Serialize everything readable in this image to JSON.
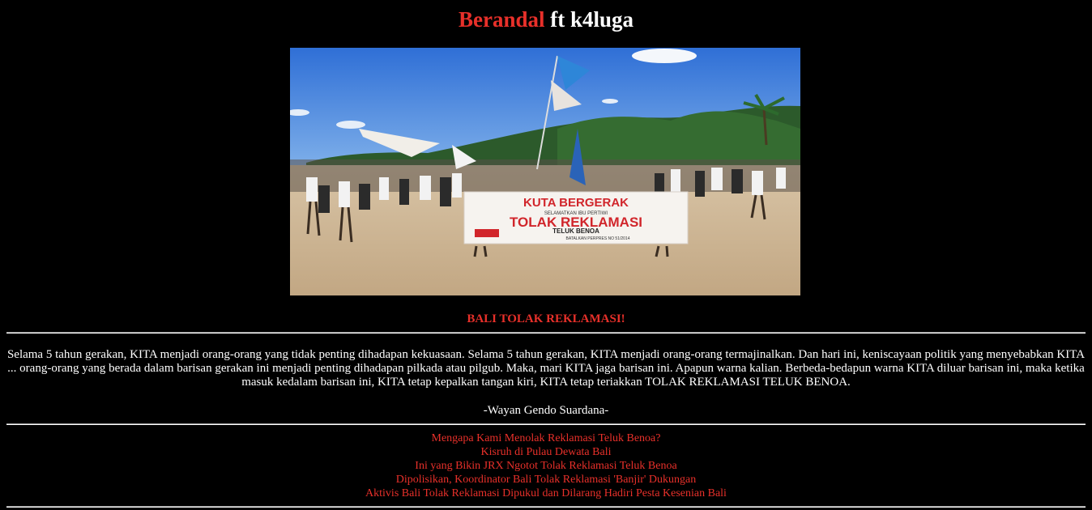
{
  "header": {
    "title_red": "Berandal",
    "title_white": " ft k4luga"
  },
  "photo": {
    "description_icon": "protest-photo",
    "banner": {
      "line1": "KUTA BERGERAK",
      "line2": "SELAMATKAN IBU PERTIWI",
      "line3": "TOLAK REKLAMASI",
      "line4": "TELUK BENOA",
      "line5": "BATALKAN PERPRES NO 51/2014"
    }
  },
  "main": {
    "headline": "BALI TOLAK REKLAMASI!",
    "paragraph": "Selama 5 tahun gerakan, KITA menjadi orang-orang yang tidak penting dihadapan kekuasaan. Selama 5 tahun gerakan, KITA menjadi orang-orang termajinalkan. Dan hari ini, keniscayaan politik yang menyebabkan KITA ... orang-orang yang berada dalam barisan gerakan ini menjadi penting dihadapan pilkada atau pilgub. Maka, mari KITA jaga barisan ini. Apapun warna kalian. Berbeda-bedapun warna KITA diluar barisan ini, maka ketika masuk kedalam barisan ini, KITA tetap kepalkan tangan kiri, KITA tetap teriakkan TOLAK REKLAMASI TELUK BENOA.",
    "author": "-Wayan Gendo Suardana-"
  },
  "links": [
    "Mengapa Kami Menolak Reklamasi Teluk Benoa?",
    "Kisruh di Pulau Dewata Bali",
    "Ini yang Bikin JRX Ngotot Tolak Reklamasi Teluk Benoa",
    "Dipolisikan, Koordinator Bali Tolak Reklamasi 'Banjir' Dukungan",
    "Aktivis Bali Tolak Reklamasi Dipukul dan Dilarang Hadiri Pesta Kesenian Bali"
  ],
  "colors": {
    "accent_red": "#e8302a",
    "background": "#000000",
    "text": "#ffffff"
  }
}
